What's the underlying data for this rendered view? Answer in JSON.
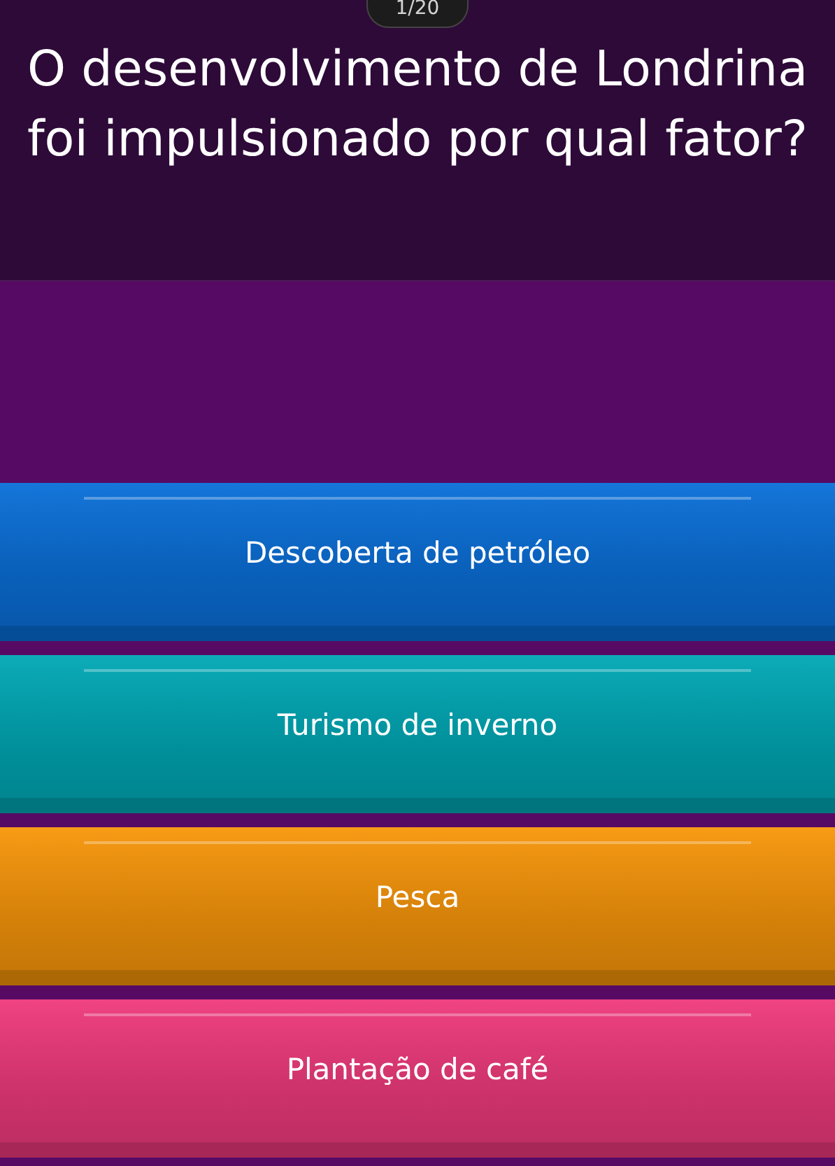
{
  "counter": "1/20",
  "question": "O desenvolvimento de Londrina foi impulsionado por qual fator?",
  "answers": [
    {
      "label": "Descoberta de petróleo",
      "color": "#0a6fd8"
    },
    {
      "label": "Turismo de inverno",
      "color": "#00a8b5"
    },
    {
      "label": "Pesca",
      "color": "#f8960a"
    },
    {
      "label": "Plantação de café",
      "color": "#ef3a7b"
    }
  ]
}
